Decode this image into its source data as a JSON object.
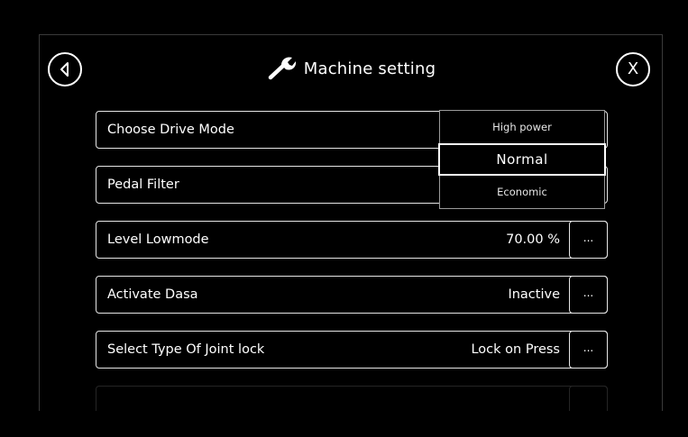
{
  "header": {
    "title": "Machine setting",
    "back_icon": "back-arrow-icon",
    "close_label": "X",
    "title_icon": "wrench-icon"
  },
  "settings": [
    {
      "label": "Choose Drive Mode",
      "value": "",
      "has_more": false
    },
    {
      "label": "Pedal Filter",
      "value": "",
      "has_more": false
    },
    {
      "label": "Level Lowmode",
      "value": "70.00 %",
      "has_more": true,
      "more_label": "..."
    },
    {
      "label": "Activate Dasa",
      "value": "Inactive",
      "has_more": true,
      "more_label": "..."
    },
    {
      "label": "Select Type Of Joint lock",
      "value": "Lock on Press",
      "has_more": true,
      "more_label": "..."
    }
  ],
  "drive_mode_dropdown": {
    "options": [
      "High power",
      "Normal",
      "Economic"
    ],
    "selected": "Normal"
  },
  "colors": {
    "background": "#000000",
    "foreground": "#ffffff",
    "border": "#e6e6e6"
  }
}
